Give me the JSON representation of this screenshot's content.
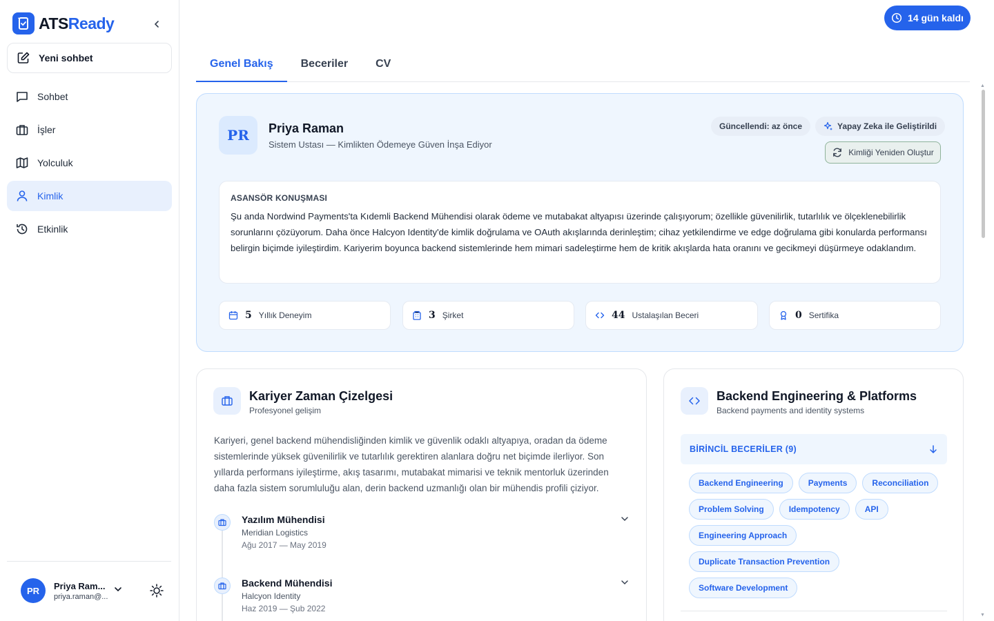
{
  "brand": {
    "name_part1": "ATS",
    "name_part2": "Ready",
    "accent": "#2563eb"
  },
  "sidebar": {
    "new_chat": "Yeni sohbet",
    "items": [
      {
        "label": "Sohbet",
        "icon": "chat-icon"
      },
      {
        "label": "İşler",
        "icon": "briefcase-icon"
      },
      {
        "label": "Yolculuk",
        "icon": "map-icon"
      },
      {
        "label": "Kimlik",
        "icon": "user-icon",
        "active": true
      },
      {
        "label": "Etkinlik",
        "icon": "history-icon"
      }
    ],
    "user": {
      "initials": "PR",
      "name": "Priya Ram...",
      "email": "priya.raman@..."
    }
  },
  "trial": {
    "label": "14 gün kaldı"
  },
  "tabs": [
    {
      "label": "Genel Bakış",
      "active": true
    },
    {
      "label": "Beceriler"
    },
    {
      "label": "CV"
    }
  ],
  "profile": {
    "initials": "PR",
    "name": "Priya Raman",
    "title": "Sistem Ustası — Kimlikten Ödemeye Güven İnşa Ediyor",
    "updated": "Güncellendi: az önce",
    "ai_badge": "Yapay Zeka ile Geliştirildi",
    "regenerate": "Kimliği Yeniden Oluştur",
    "pitch_label": "ASANSÖR KONUŞMASI",
    "pitch_text": "Şu anda Nordwind Payments'ta Kıdemli Backend Mühendisi olarak ödeme ve mutabakat altyapısı üzerinde çalışıyorum; özellikle güvenilirlik, tutarlılık ve ölçeklenebilirlik sorunlarını çözüyorum. Daha önce Halcyon Identity'de kimlik doğrulama ve OAuth akışlarında derinleştim; cihaz yetkilendirme ve edge doğrulama gibi konularda performansı belirgin biçimde iyileştirdim. Kariyerim boyunca backend sistemlerinde hem mimari sadeleştirme hem de kritik akışlarda hata oranını ve gecikmeyi düşürmeye odaklandım.",
    "stats": [
      {
        "value": "5",
        "label": "Yıllık Deneyim",
        "icon": "calendar-icon"
      },
      {
        "value": "3",
        "label": "Şirket",
        "icon": "building-icon"
      },
      {
        "value": "44",
        "label": "Ustalaşılan Beceri",
        "icon": "code-icon"
      },
      {
        "value": "0",
        "label": "Sertifika",
        "icon": "award-icon"
      }
    ]
  },
  "career": {
    "title": "Kariyer Zaman Çizelgesi",
    "subtitle": "Profesyonel gelişim",
    "summary": "Kariyeri, genel backend mühendisliğinden kimlik ve güvenlik odaklı altyapıya, oradan da ödeme sistemlerinde yüksek güvenilirlik ve tutarlılık gerektiren alanlara doğru net biçimde ilerliyor. Son yıllarda performans iyileştirme, akış tasarımı, mutabakat mimarisi ve teknik mentorluk üzerinden daha fazla sistem sorumluluğu alan, derin backend uzmanlığı olan bir mühendis profili çiziyor.",
    "items": [
      {
        "role": "Yazılım Mühendisi",
        "company": "Meridian Logistics",
        "dates": "Ağu 2017 — May 2019"
      },
      {
        "role": "Backend Mühendisi",
        "company": "Halcyon Identity",
        "dates": "Haz 2019 — Şub 2022"
      }
    ]
  },
  "skills": {
    "title": "Backend Engineering & Platforms",
    "subtitle": "Backend payments and identity systems",
    "primary_label": "BİRİNCİL BECERİLER (9)",
    "rows": [
      [
        "Backend Engineering",
        "Payments",
        "Reconciliation"
      ],
      [
        "Problem Solving",
        "Idempotency",
        "API"
      ],
      [
        "Engineering Approach"
      ],
      [
        "Duplicate Transaction Prevention"
      ],
      [
        "Software Development"
      ]
    ]
  }
}
